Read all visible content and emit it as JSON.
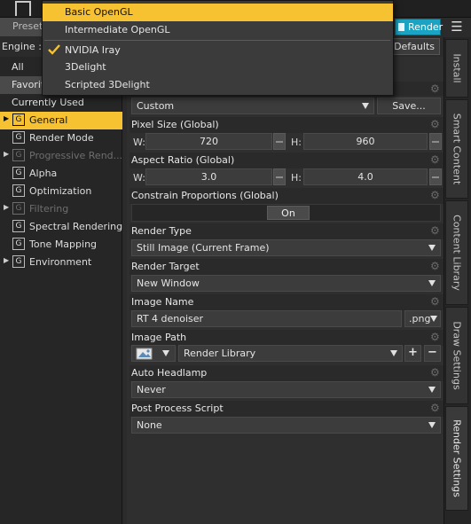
{
  "toolbar": {
    "preset_tab": "Preset",
    "render_button": "Render",
    "engine_label": "Engine :",
    "defaults_button": "Defaults"
  },
  "filter_tabs": [
    "All",
    "Favorit",
    "Currently Used"
  ],
  "nav": [
    {
      "label": "General",
      "expandable": true,
      "active": true,
      "dim": false
    },
    {
      "label": "Render Mode",
      "expandable": false,
      "active": false,
      "dim": false
    },
    {
      "label": "Progressive Rend...",
      "expandable": true,
      "active": false,
      "dim": true
    },
    {
      "label": "Alpha",
      "expandable": false,
      "active": false,
      "dim": false
    },
    {
      "label": "Optimization",
      "expandable": false,
      "active": false,
      "dim": false
    },
    {
      "label": "Filtering",
      "expandable": true,
      "active": false,
      "dim": true
    },
    {
      "label": "Spectral Rendering",
      "expandable": false,
      "active": false,
      "dim": false
    },
    {
      "label": "Tone Mapping",
      "expandable": false,
      "active": false,
      "dim": false
    },
    {
      "label": "Environment",
      "expandable": true,
      "active": false,
      "dim": false
    }
  ],
  "settings": {
    "preset_value": "Custom",
    "save_button": "Save...",
    "pixel_size": {
      "label": "Pixel Size (Global)",
      "w_label": "W:",
      "w": "720",
      "h_label": "H:",
      "h": "960"
    },
    "aspect_ratio": {
      "label": "Aspect Ratio (Global)",
      "w_label": "W:",
      "w": "3.0",
      "h_label": "H:",
      "h": "4.0"
    },
    "constrain": {
      "label": "Constrain Proportions (Global)",
      "value": "On"
    },
    "render_type": {
      "label": "Render Type",
      "value": "Still Image (Current Frame)"
    },
    "render_target": {
      "label": "Render Target",
      "value": "New Window"
    },
    "image_name": {
      "label": "Image Name",
      "value": "RT 4 denoiser",
      "ext": ".png"
    },
    "image_path": {
      "label": "Image Path",
      "value": "Render Library",
      "add": "+",
      "remove": "−"
    },
    "auto_headlamp": {
      "label": "Auto Headlamp",
      "value": "Never"
    },
    "post_process": {
      "label": "Post Process Script",
      "value": "None"
    }
  },
  "right_tabs": [
    "Install",
    "Smart Content",
    "Content Library",
    "Draw Settings",
    "Render Settings"
  ],
  "engine_menu": {
    "items": [
      {
        "label": "Basic OpenGL",
        "highlighted": true,
        "checked": false
      },
      {
        "label": "Intermediate OpenGL",
        "highlighted": false,
        "checked": false
      },
      {
        "label": "NVIDIA Iray",
        "highlighted": false,
        "checked": true
      },
      {
        "label": "3Delight",
        "highlighted": false,
        "checked": false
      },
      {
        "label": "Scripted 3Delight",
        "highlighted": false,
        "checked": false
      }
    ]
  },
  "colors": {
    "accent": "#f7c232",
    "render": "#1aa3c3"
  },
  "icons": {
    "gear": "gear-icon",
    "check": "checkmark-icon",
    "image": "image-icon",
    "menu": "hamburger-icon"
  }
}
